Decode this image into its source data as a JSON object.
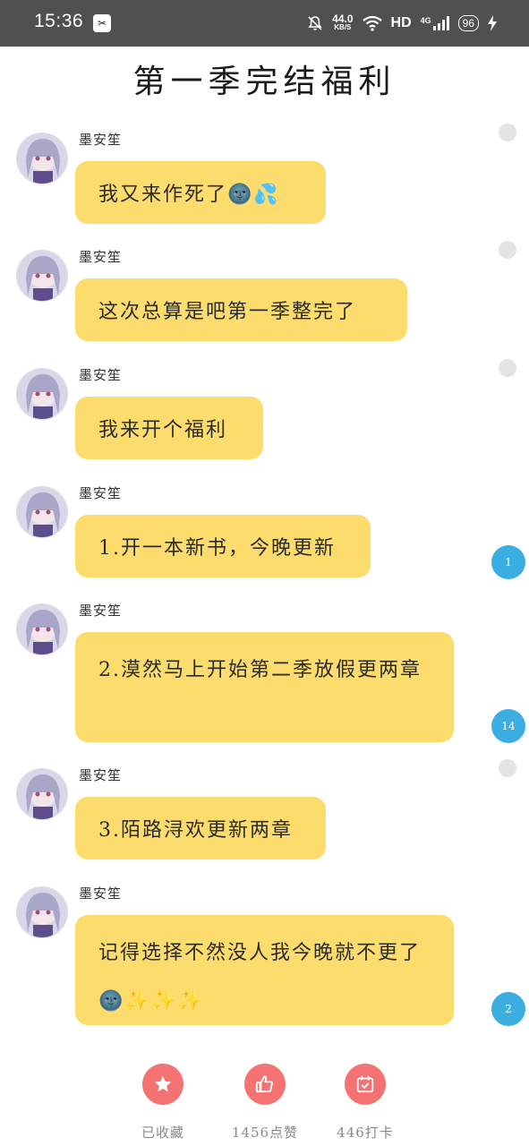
{
  "status_bar": {
    "time": "15:36",
    "net_speed_value": "44.0",
    "net_speed_unit": "KB/S",
    "hd_label": "HD",
    "signal_label": "4G",
    "battery": "96"
  },
  "page": {
    "title": "第一季完结福利"
  },
  "messages": [
    {
      "sender": "墨安笙",
      "text": "我又来作死了🌚💦"
    },
    {
      "sender": "墨安笙",
      "text": "这次总算是吧第一季整完了"
    },
    {
      "sender": "墨安笙",
      "text": "我来开个福利"
    },
    {
      "sender": "墨安笙",
      "text": "1.开一本新书，今晚更新",
      "comment_count": "1"
    },
    {
      "sender": "墨安笙",
      "text": "2.漠然马上开始第二季放假更两章",
      "comment_count": "14"
    },
    {
      "sender": "墨安笙",
      "text": "3.陌路浔欢更新两章"
    },
    {
      "sender": "墨安笙",
      "text": "记得选择不然没人我今晚就不更了🌚✨✨✨",
      "comment_count": "2"
    }
  ],
  "actions": [
    {
      "label": "已收藏",
      "icon": "star-icon"
    },
    {
      "label": "1456点赞",
      "icon": "thumbs-up-icon"
    },
    {
      "label": "446打卡",
      "icon": "calendar-check-icon"
    }
  ],
  "colors": {
    "status_bar_bg": "#505050",
    "bubble": "#fddc6e",
    "comment_badge": "#3aaee0",
    "action_button": "#f47272"
  }
}
